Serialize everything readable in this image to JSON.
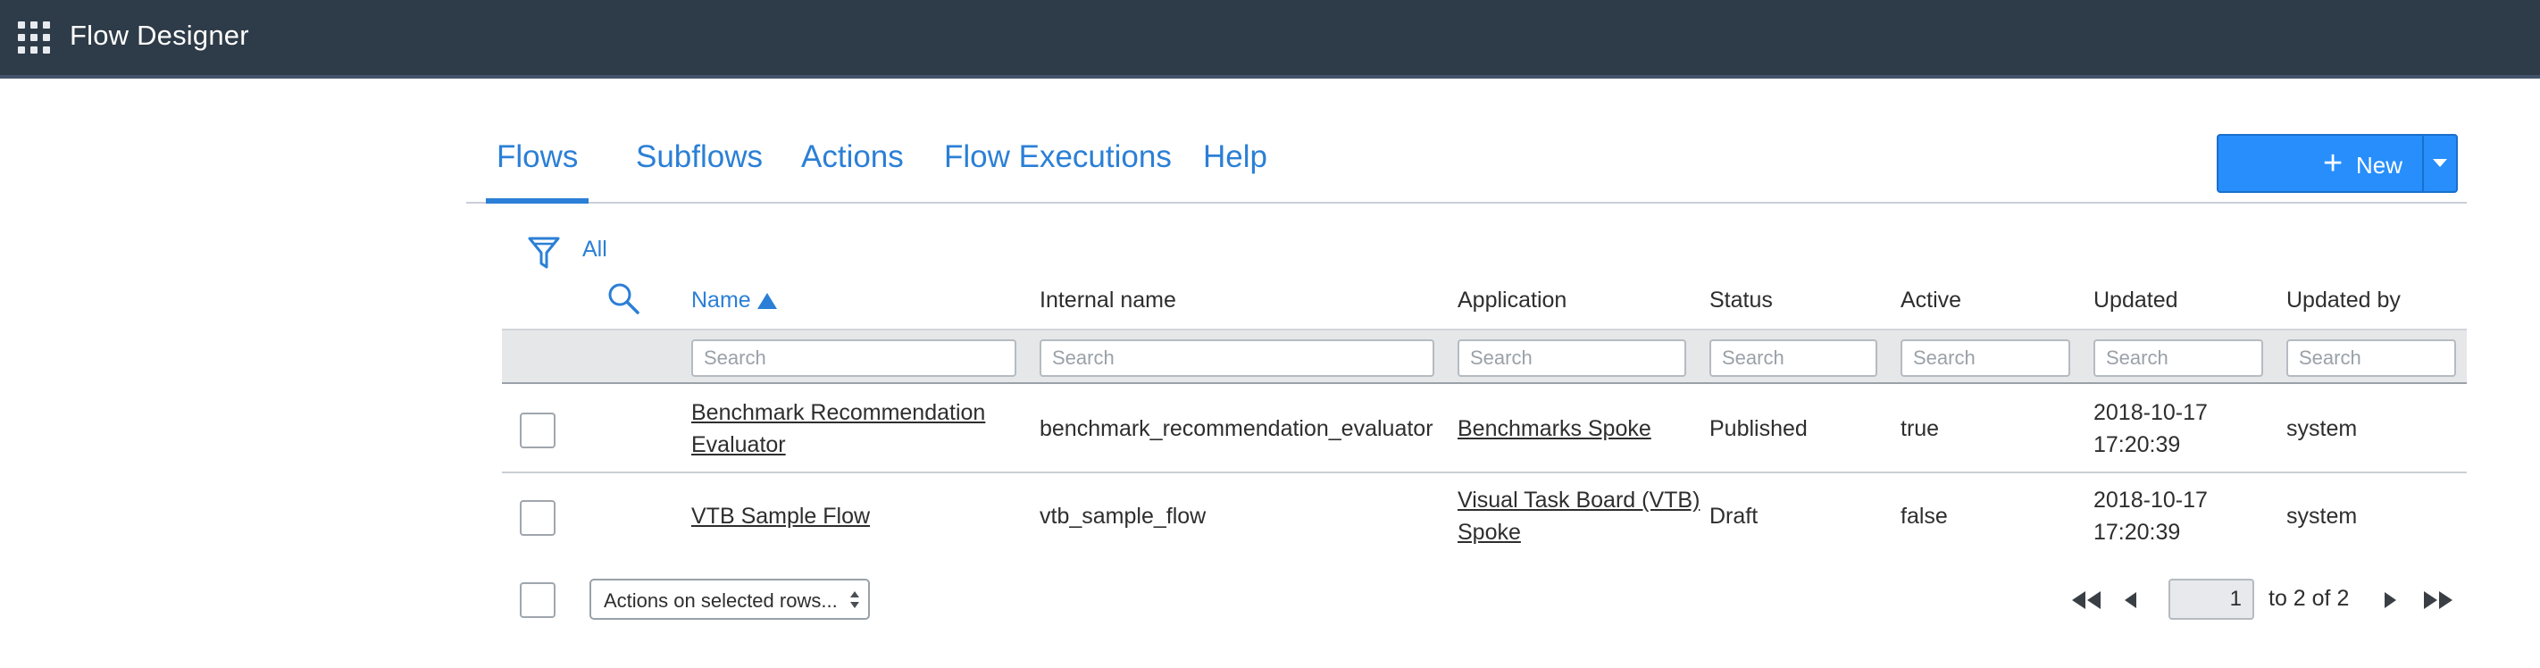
{
  "header": {
    "title": "Flow Designer"
  },
  "tabs": [
    {
      "label": "Flows"
    },
    {
      "label": "Subflows"
    },
    {
      "label": "Actions"
    },
    {
      "label": "Flow Executions"
    },
    {
      "label": "Help"
    }
  ],
  "new_button": {
    "label": "New"
  },
  "filter": {
    "label": "All"
  },
  "columns": [
    {
      "label": "Name",
      "sort": "ascending"
    },
    {
      "label": "Internal name"
    },
    {
      "label": "Application"
    },
    {
      "label": "Status"
    },
    {
      "label": "Active"
    },
    {
      "label": "Updated"
    },
    {
      "label": "Updated by"
    }
  ],
  "search_placeholder": "Search",
  "rows": [
    {
      "name": [
        "Benchmark Recommendation",
        "Evaluator"
      ],
      "internal_name": "benchmark_recommendation_evaluator",
      "application": [
        "Benchmarks Spoke"
      ],
      "status": "Published",
      "active": "true",
      "updated": [
        "2018-10-17",
        "17:20:39"
      ],
      "updated_by": "system"
    },
    {
      "name": [
        "VTB Sample Flow"
      ],
      "internal_name": "vtb_sample_flow",
      "application": [
        "Visual Task Board (VTB)",
        "Spoke"
      ],
      "status": "Draft",
      "active": "false",
      "updated": [
        "2018-10-17",
        "17:20:39"
      ],
      "updated_by": "system"
    }
  ],
  "footer": {
    "actions_select": "Actions on selected rows...",
    "page": "1",
    "range": "to 2 of 2"
  },
  "colors": {
    "header_bg": "#2e3b48",
    "accent": "#2b7fd6",
    "new_button": "#278efc"
  },
  "icons": [
    "app-grid-icon",
    "filter-icon",
    "search-icon",
    "sort-ascending-icon",
    "plus-icon",
    "first-page-icon",
    "previous-page-icon",
    "next-page-icon",
    "last-page-icon"
  ]
}
